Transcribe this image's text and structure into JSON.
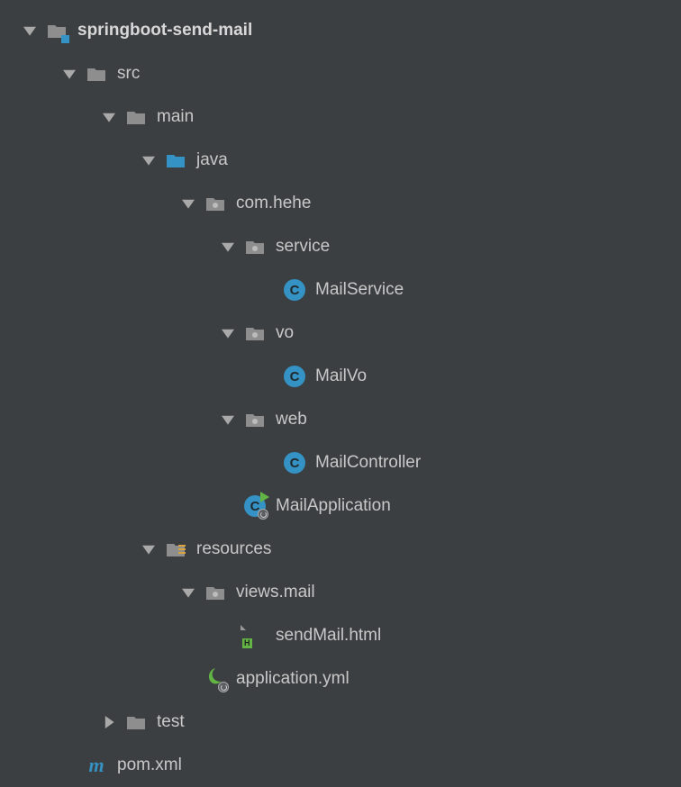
{
  "tree": {
    "root": {
      "label": "springboot-send-mail",
      "expanded": true
    },
    "src": {
      "label": "src",
      "expanded": true
    },
    "main": {
      "label": "main",
      "expanded": true
    },
    "java": {
      "label": "java",
      "expanded": true
    },
    "package_root": {
      "label": "com.hehe",
      "expanded": true
    },
    "service": {
      "label": "service",
      "expanded": true
    },
    "mail_service": {
      "label": "MailService"
    },
    "vo": {
      "label": "vo",
      "expanded": true
    },
    "mail_vo": {
      "label": "MailVo"
    },
    "web": {
      "label": "web",
      "expanded": true
    },
    "mail_controller": {
      "label": "MailController"
    },
    "mail_application": {
      "label": "MailApplication"
    },
    "resources": {
      "label": "resources",
      "expanded": true
    },
    "views_mail": {
      "label": "views.mail",
      "expanded": true
    },
    "send_mail_html": {
      "label": "sendMail.html"
    },
    "application_yml": {
      "label": "application.yml"
    },
    "test": {
      "label": "test",
      "expanded": false
    },
    "pom_xml": {
      "label": "pom.xml"
    }
  },
  "class_letter": "C",
  "html_badge_letter": "H"
}
